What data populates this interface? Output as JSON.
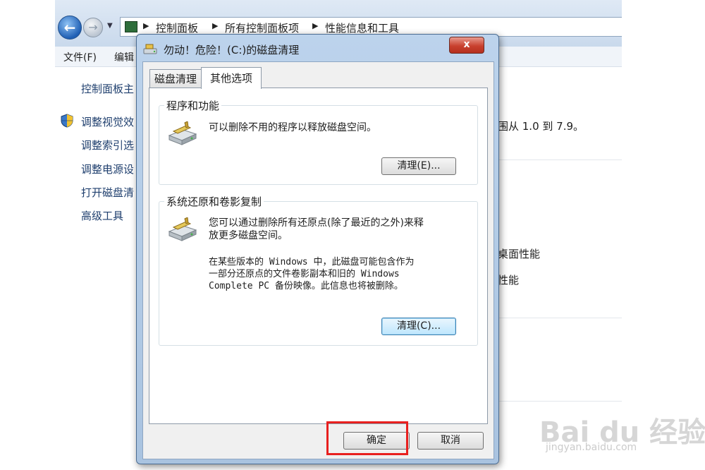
{
  "control_panel": {
    "breadcrumb": [
      "控制面板",
      "所有控制面板项",
      "性能信息和工具"
    ],
    "menu": [
      "文件(F)",
      "编辑"
    ],
    "sidebar": [
      "控制面板主",
      "调整视觉效",
      "调整索引选",
      "调整电源设",
      "打开磁盘清",
      "高级工具"
    ],
    "main_fragments": [
      "围从 1.0 到 7.9。",
      "桌面性能",
      "性能"
    ]
  },
  "dialog": {
    "title": "勿动！危险！(C:)的磁盘清理",
    "close_label": "x",
    "tabs": [
      "磁盘清理",
      "其他选项"
    ],
    "active_tab": 1,
    "programs": {
      "legend": "程序和功能",
      "description": "可以删除不用的程序以释放磁盘空间。",
      "button": "清理(E)..."
    },
    "restore": {
      "legend": "系统还原和卷影复制",
      "description_1": "您可以通过删除所有还原点(除了最近的之外)来释放更多磁盘空间。",
      "description_1_lines": [
        "您可以通过删除所有还原点(除了最近的之外)来释",
        "放更多磁盘空间。"
      ],
      "description_2": "在某些版本的 Windows 中，此磁盘可能包含作为一部分还原点的文件卷影副本和旧的 Windows Complete PC 备份映像。此信息也将被删除。",
      "description_2_lines": [
        "在某些版本的 Windows 中，此磁盘可能包含作为",
        "一部分还原点的文件卷影副本和旧的 Windows",
        "Complete PC 备份映像。此信息也将被删除。"
      ],
      "button": "清理(C)..."
    },
    "ok_label": "确定",
    "cancel_label": "取消"
  },
  "highlight_color": "#e8201f",
  "watermark": {
    "logo": "Bai du 经验",
    "url": "jingyan.baidu.com"
  }
}
